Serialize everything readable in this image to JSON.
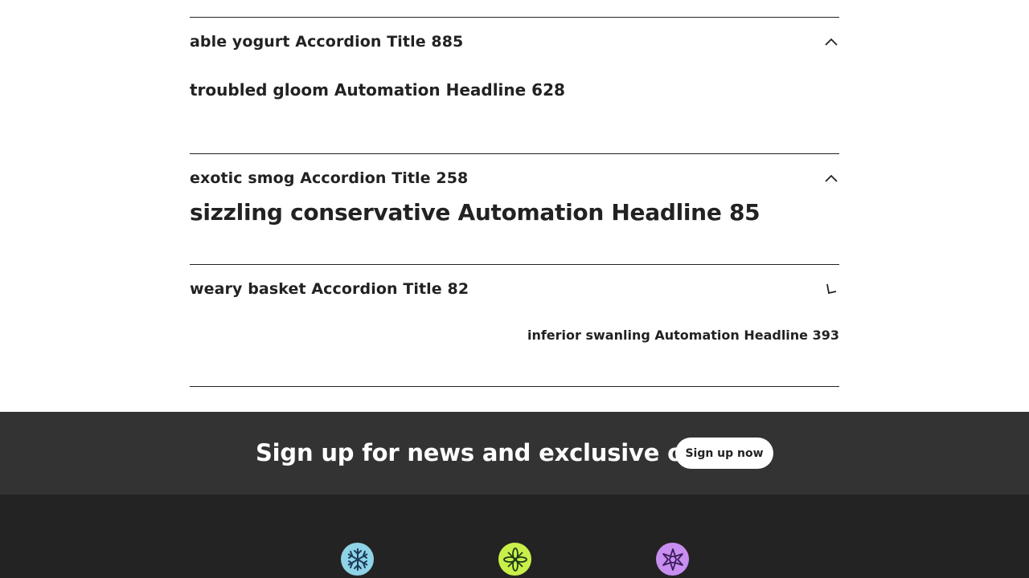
{
  "accordion": {
    "items": [
      {
        "title": "able yogurt Accordion Title 885",
        "headline": "troubled gloom Automation Headline 628",
        "state": "expanded",
        "icon": "chevron-up-icon"
      },
      {
        "title": "exotic smog Accordion Title 258",
        "headline": "sizzling conservative Automation Headline 85",
        "state": "expanded",
        "icon": "chevron-up-icon"
      },
      {
        "title": "weary basket Accordion Title 82",
        "headline": "inferior swanling Automation Headline 393",
        "state": "animating",
        "icon": "chevron-rotating-icon"
      }
    ]
  },
  "newsletter": {
    "text": "Sign up for news and exclusive offers",
    "button_label": "Sign up now"
  },
  "footer": {
    "badges": [
      {
        "icon": "snowflake-icon",
        "background": "#8fd3e6",
        "color": "#1c3b5a"
      },
      {
        "icon": "flower-icon",
        "background": "#c9f04a",
        "color": "#1f3a18"
      },
      {
        "icon": "star-burst-icon",
        "background": "#c88ef0",
        "color": "#3a1c5a"
      }
    ]
  },
  "colors": {
    "text": "#222222",
    "newsletter_bg": "#333333",
    "footer_bg": "#232323"
  }
}
